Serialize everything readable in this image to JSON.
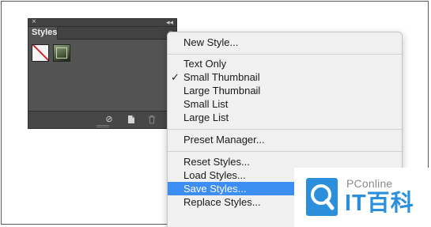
{
  "panel": {
    "tab_label": "Styles",
    "close_glyph": "×",
    "collapse_glyph": "◂◂",
    "menu_glyph": "≡",
    "bottom_icons": [
      "clear-style-icon",
      "new-style-icon",
      "delete-style-icon"
    ]
  },
  "menu": {
    "items": [
      {
        "label": "New Style...",
        "checked": false,
        "highlighted": false
      },
      {
        "label": "Text Only",
        "checked": false,
        "highlighted": false
      },
      {
        "label": "Small Thumbnail",
        "checked": true,
        "highlighted": false
      },
      {
        "label": "Large Thumbnail",
        "checked": false,
        "highlighted": false
      },
      {
        "label": "Small List",
        "checked": false,
        "highlighted": false
      },
      {
        "label": "Large List",
        "checked": false,
        "highlighted": false
      },
      {
        "label": "Preset Manager...",
        "checked": false,
        "highlighted": false
      },
      {
        "label": "Reset Styles...",
        "checked": false,
        "highlighted": false
      },
      {
        "label": "Load Styles...",
        "checked": false,
        "highlighted": false
      },
      {
        "label": "Save Styles...",
        "checked": false,
        "highlighted": true
      },
      {
        "label": "Replace Styles...",
        "checked": false,
        "highlighted": false
      }
    ],
    "check_glyph": "✓",
    "highlight_color": "#3d8ef3"
  },
  "watermark": {
    "brand": "PConline",
    "name": "IT百科",
    "color": "#2b8fdc"
  }
}
